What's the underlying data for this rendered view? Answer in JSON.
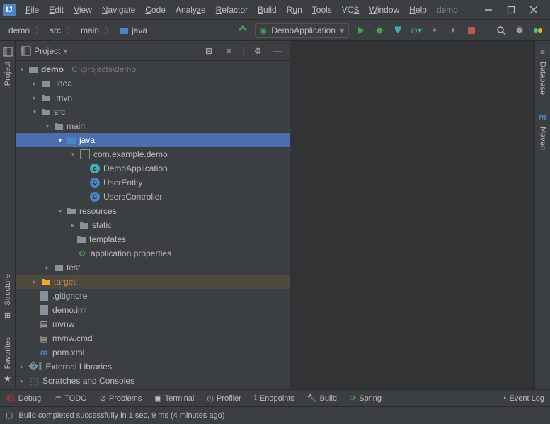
{
  "menu": [
    "File",
    "Edit",
    "View",
    "Navigate",
    "Code",
    "Analyze",
    "Refactor",
    "Build",
    "Run",
    "Tools",
    "VCS",
    "Window",
    "Help"
  ],
  "title": "demo",
  "breadcrumb": [
    "demo",
    "src",
    "main",
    "java"
  ],
  "runConfig": "DemoApplication",
  "leftTabs": [
    "Project",
    "Structure",
    "Favorites"
  ],
  "rightTabs": [
    "Database",
    "Maven"
  ],
  "panel": {
    "title": "Project"
  },
  "tree": {
    "root": "demo",
    "rootPath": "C:\\projects\\demo",
    "idea": ".idea",
    "mvn": ".mvn",
    "src": "src",
    "main": "main",
    "java": "java",
    "pkg": "com.example.demo",
    "f1": "DemoApplication",
    "f2": "UserEntity",
    "f3": "UsersController",
    "resources": "resources",
    "static": "static",
    "templates": "templates",
    "props": "application.properties",
    "test": "test",
    "target": "target",
    "gitignore": ".gitignore",
    "iml": "demo.iml",
    "mvnw": "mvnw",
    "mvnwcmd": "mvnw.cmd",
    "pom": "pom.xml",
    "extlib": "External Libraries",
    "scratches": "Scratches and Consoles"
  },
  "bottomTabs": [
    "Debug",
    "TODO",
    "Problems",
    "Terminal",
    "Profiler",
    "Endpoints",
    "Build",
    "Spring"
  ],
  "eventLog": "Event Log",
  "status": "Build completed successfully in 1 sec, 9 ms (4 minutes ago)"
}
